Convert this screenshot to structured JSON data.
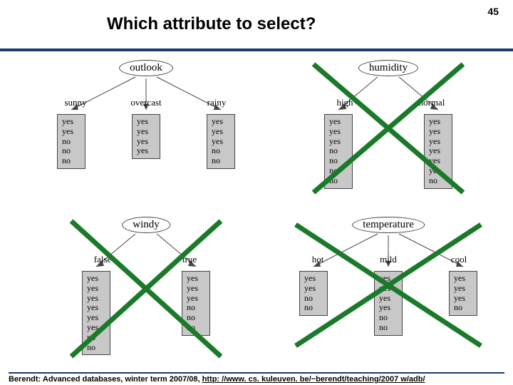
{
  "page_number": "45",
  "title": "Which attribute to select?",
  "footer_prefix": "Berendt: Advanced databases, winter term 2007/08, ",
  "footer_link": "http: //www. cs. kuleuven. be/~berendt/teaching/2007 w/adb/",
  "trees": {
    "outlook": {
      "root": "outlook",
      "crossed": false,
      "branches": [
        {
          "label": "sunny",
          "leaf": [
            "yes",
            "yes",
            "no",
            "no",
            "no"
          ]
        },
        {
          "label": "overcast",
          "leaf": [
            "yes",
            "yes",
            "yes",
            "yes"
          ]
        },
        {
          "label": "rainy",
          "leaf": [
            "yes",
            "yes",
            "yes",
            "no",
            "no"
          ]
        }
      ]
    },
    "humidity": {
      "root": "humidity",
      "crossed": true,
      "branches": [
        {
          "label": "high",
          "leaf": [
            "yes",
            "yes",
            "yes",
            "no",
            "no",
            "no",
            "no"
          ]
        },
        {
          "label": "normal",
          "leaf": [
            "yes",
            "yes",
            "yes",
            "yes",
            "yes",
            "yes",
            "no"
          ]
        }
      ]
    },
    "windy": {
      "root": "windy",
      "crossed": true,
      "branches": [
        {
          "label": "false",
          "leaf": [
            "yes",
            "yes",
            "yes",
            "yes",
            "yes",
            "yes",
            "no",
            "no"
          ]
        },
        {
          "label": "true",
          "leaf": [
            "yes",
            "yes",
            "yes",
            "no",
            "no",
            "no"
          ]
        }
      ]
    },
    "temperature": {
      "root": "temperature",
      "crossed": true,
      "branches": [
        {
          "label": "hot",
          "leaf": [
            "yes",
            "yes",
            "no",
            "no"
          ]
        },
        {
          "label": "mild",
          "leaf": [
            "yes",
            "yes",
            "yes",
            "yes",
            "no",
            "no"
          ]
        },
        {
          "label": "cool",
          "leaf": [
            "yes",
            "yes",
            "yes",
            "no"
          ]
        }
      ]
    }
  }
}
